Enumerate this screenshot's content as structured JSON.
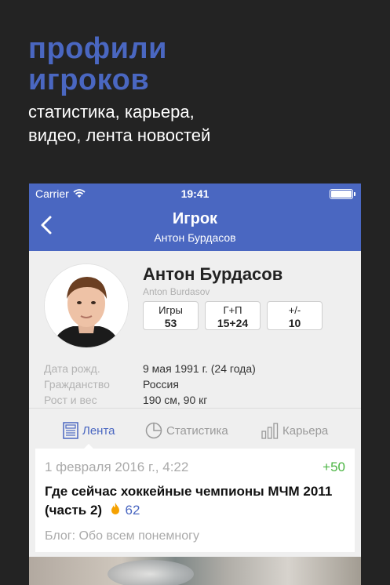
{
  "promo": {
    "headline_line1": "профили",
    "headline_line2": "игроков",
    "sub_line1": "статистика, карьера,",
    "sub_line2": "видео, лента новостей"
  },
  "statusbar": {
    "carrier": "Carrier",
    "time": "19:41"
  },
  "navbar": {
    "title": "Игрок",
    "subtitle": "Антон Бурдасов"
  },
  "player": {
    "name": "Антон Бурдасов",
    "latin_name": "Anton Burdasov",
    "stats": [
      {
        "label": "Игры",
        "value": "53"
      },
      {
        "label": "Г+П",
        "value": "15+24"
      },
      {
        "label": "+/-",
        "value": "10"
      }
    ],
    "info": [
      {
        "key": "Дата рожд.",
        "value": "9 мая 1991 г. (24 года)"
      },
      {
        "key": "Гражданство",
        "value": "Россия"
      },
      {
        "key": "Рост и вес",
        "value": "190 см, 90 кг"
      }
    ]
  },
  "tabs": [
    {
      "label": "Лента",
      "icon": "feed-icon",
      "active": true
    },
    {
      "label": "Статистика",
      "icon": "pie-chart-icon",
      "active": false
    },
    {
      "label": "Карьера",
      "icon": "bar-chart-icon",
      "active": false
    }
  ],
  "feed_card": {
    "date": "1 февраля 2016 г., 4:22",
    "rating": "+50",
    "title": "Где сейчас хоккейные чемпионы МЧМ 2011 (часть 2)",
    "hot_count": "62",
    "blog": "Блог: Обо всем понемногу"
  },
  "colors": {
    "accent": "#4a67c1",
    "background": "#232323",
    "positive": "#4bb543"
  }
}
